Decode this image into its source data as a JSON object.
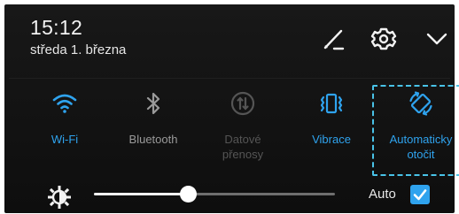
{
  "header": {
    "time": "15:12",
    "date": "středa 1. března"
  },
  "icons": {
    "edit": "edit-pencil-icon",
    "settings": "gear-icon",
    "collapse": "chevron-down-icon"
  },
  "tiles": [
    {
      "label": "Wi-Fi",
      "state": "on",
      "icon": "wifi-icon",
      "color": "#2fa3ee"
    },
    {
      "label": "Bluetooth",
      "state": "off",
      "icon": "bluetooth-icon",
      "color": "#9a9a9a"
    },
    {
      "label": "Datové\npřenosy",
      "state": "disabled",
      "icon": "mobile-data-icon",
      "color": "#555555"
    },
    {
      "label": "Vibrace",
      "state": "on",
      "icon": "vibrate-icon",
      "color": "#2fa3ee"
    },
    {
      "label": "Automaticky\notočit",
      "state": "on",
      "icon": "auto-rotate-icon",
      "color": "#2fa3ee",
      "highlighted": true
    }
  ],
  "brightness": {
    "level": 0.39,
    "auto_label": "Auto",
    "auto_checked": true,
    "icon": "brightness-icon"
  },
  "colors": {
    "accent": "#2fa3ee",
    "highlight_border": "#49c3e8",
    "panel_bg": "#141414"
  }
}
